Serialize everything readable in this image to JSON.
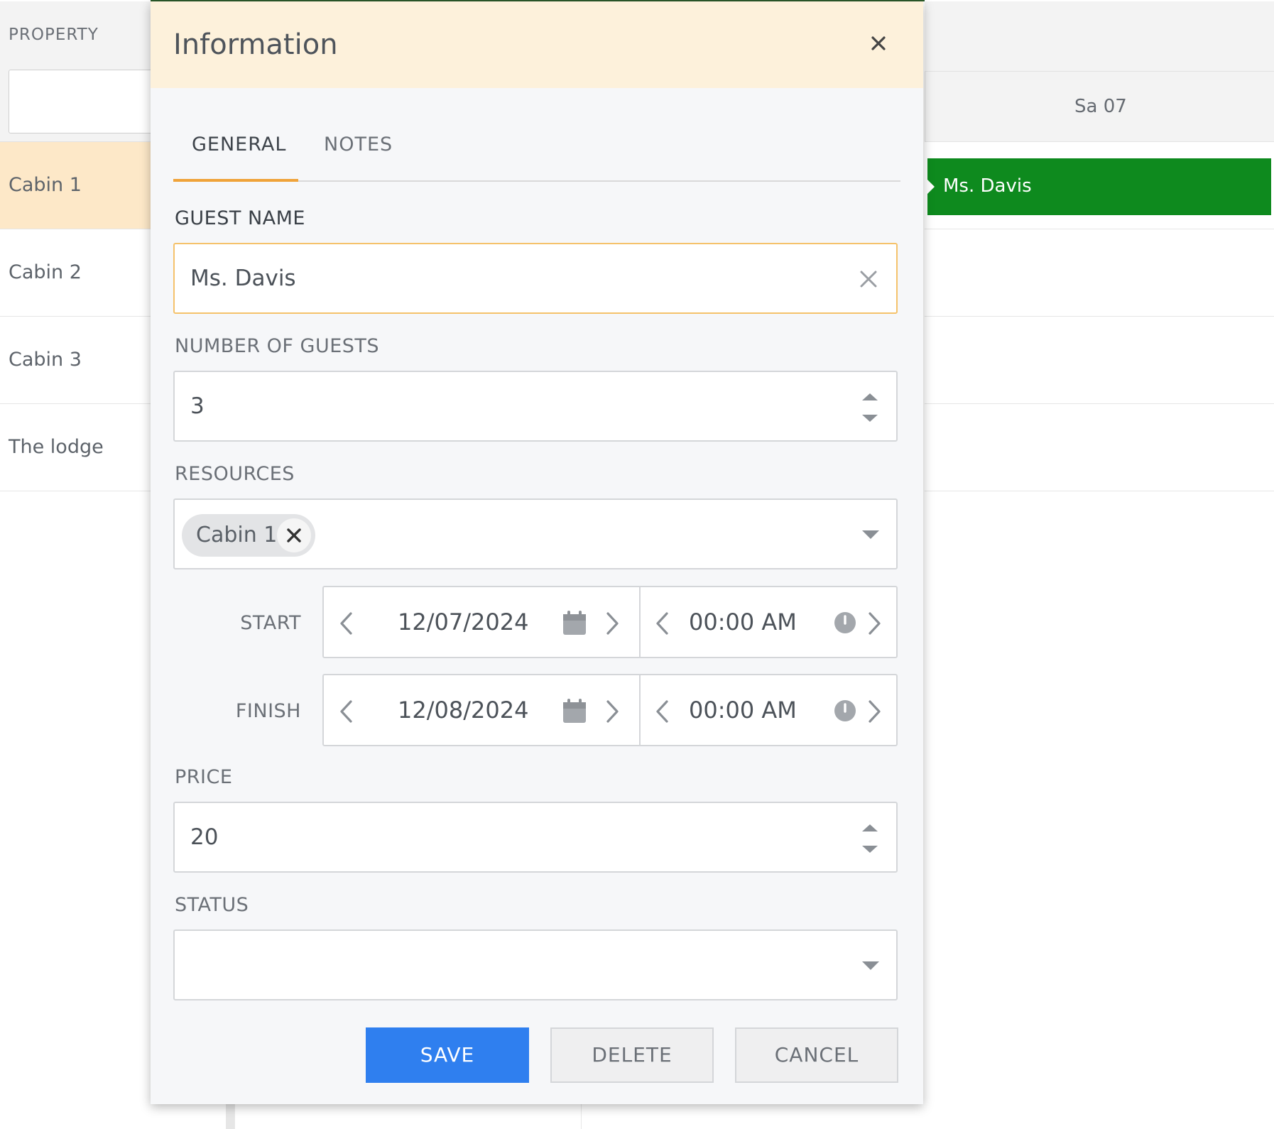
{
  "scheduler": {
    "property_label": "PROPERTY",
    "resources": [
      "Cabin 1",
      "Cabin 2",
      "Cabin 3",
      "The lodge"
    ],
    "selected_resource": "Cabin 1",
    "day_header": "Sa 07",
    "event": {
      "label": "Ms. Davis",
      "color": "#0e8a1e"
    }
  },
  "modal": {
    "title": "Information",
    "tabs": [
      {
        "label": "GENERAL",
        "active": true
      },
      {
        "label": "NOTES",
        "active": false
      }
    ],
    "guest_name": {
      "label": "GUEST NAME",
      "value": "Ms. Davis"
    },
    "number_of_guests": {
      "label": "NUMBER OF GUESTS",
      "value": "3"
    },
    "resources": {
      "label": "RESOURCES",
      "chips": [
        "Cabin 1"
      ]
    },
    "start": {
      "label": "START",
      "date": "12/07/2024",
      "time": "00:00 AM"
    },
    "finish": {
      "label": "FINISH",
      "date": "12/08/2024",
      "time": "00:00 AM"
    },
    "price": {
      "label": "PRICE",
      "value": "20"
    },
    "status": {
      "label": "STATUS",
      "value": ""
    },
    "buttons": {
      "save": "SAVE",
      "delete": "DELETE",
      "cancel": "CANCEL"
    }
  },
  "colors": {
    "accent": "#f0a33a",
    "primary_button": "#2f7fef",
    "header_bg": "#fdf1db",
    "selected_row": "#fde8c8"
  },
  "icons": {
    "close": "close-icon",
    "clear": "clear-icon",
    "spinner": "spinner-arrows-icon",
    "dropdown": "chevron-down-icon",
    "calendar": "calendar-icon",
    "clock": "clock-icon",
    "prev": "chevron-left-icon",
    "next": "chevron-right-icon"
  }
}
